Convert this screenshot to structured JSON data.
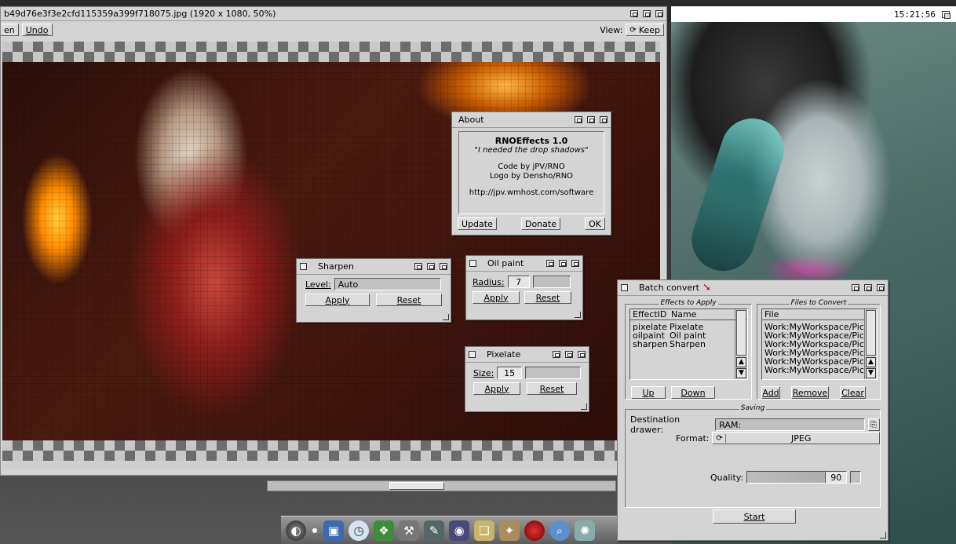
{
  "viewer": {
    "title": "b49d76e3f3e2cfd115359a399f718075.jpg (1920 x 1080, 50%)",
    "open_label_fragment": "en",
    "undo_label": "Undo",
    "view_label": "View:",
    "keep_label": "Keep"
  },
  "clock": "15:21:56",
  "about": {
    "title": "About",
    "app_name": "RNOEffects 1.0",
    "tagline": "\"I needed the drop shadows\"",
    "code_credit": "Code by jPV/RNO",
    "logo_credit": "Logo by Densho/RNO",
    "url": "http://jpv.wmhost.com/software",
    "update_label": "Update",
    "donate_label": "Donate",
    "ok_label": "OK"
  },
  "sharpen": {
    "title": "Sharpen",
    "level_label": "Level:",
    "level_value": "Auto",
    "apply_label": "Apply",
    "reset_label": "Reset"
  },
  "oilpaint": {
    "title": "Oil paint",
    "radius_label": "Radius:",
    "radius_value": "7",
    "apply_label": "Apply",
    "reset_label": "Reset"
  },
  "pixelate": {
    "title": "Pixelate",
    "size_label": "Size:",
    "size_value": "15",
    "apply_label": "Apply",
    "reset_label": "Reset"
  },
  "batch": {
    "title": "Batch convert",
    "effects_group": "Effects to Apply",
    "files_group": "Files to Convert",
    "effects_columns": [
      "EffectID",
      "Name"
    ],
    "effects": [
      {
        "id": "pixelate",
        "name": "Pixelate"
      },
      {
        "id": "oilpaint",
        "name": "Oil paint"
      },
      {
        "id": "sharpen",
        "name": "Sharpen"
      }
    ],
    "files_column": "File",
    "files": [
      "Work:MyWorkspace/Pictur",
      "Work:MyWorkspace/Pictur",
      "Work:MyWorkspace/Pictur",
      "Work:MyWorkspace/Pictur",
      "Work:MyWorkspace/Pictur",
      "Work:MyWorkspace/Pictur"
    ],
    "up_label": "Up",
    "down_label": "Down",
    "add_label": "Add",
    "remove_label": "Remove",
    "clear_label": "Clear",
    "saving_group": "Saving",
    "destination_label": "Destination drawer:",
    "destination_value": "RAM:",
    "format_label": "Format:",
    "format_value": "JPEG",
    "quality_label": "Quality:",
    "quality_value": "90",
    "start_label": "Start"
  },
  "dock": {
    "icons": [
      "ambient-icon",
      "dot-icon",
      "drawer-icon",
      "clock-icon",
      "book-icon",
      "tools-icon",
      "paint-icon",
      "eye-icon",
      "documents-icon",
      "palette-icon",
      "record-icon",
      "magnifier-icon",
      "network-icon"
    ]
  }
}
